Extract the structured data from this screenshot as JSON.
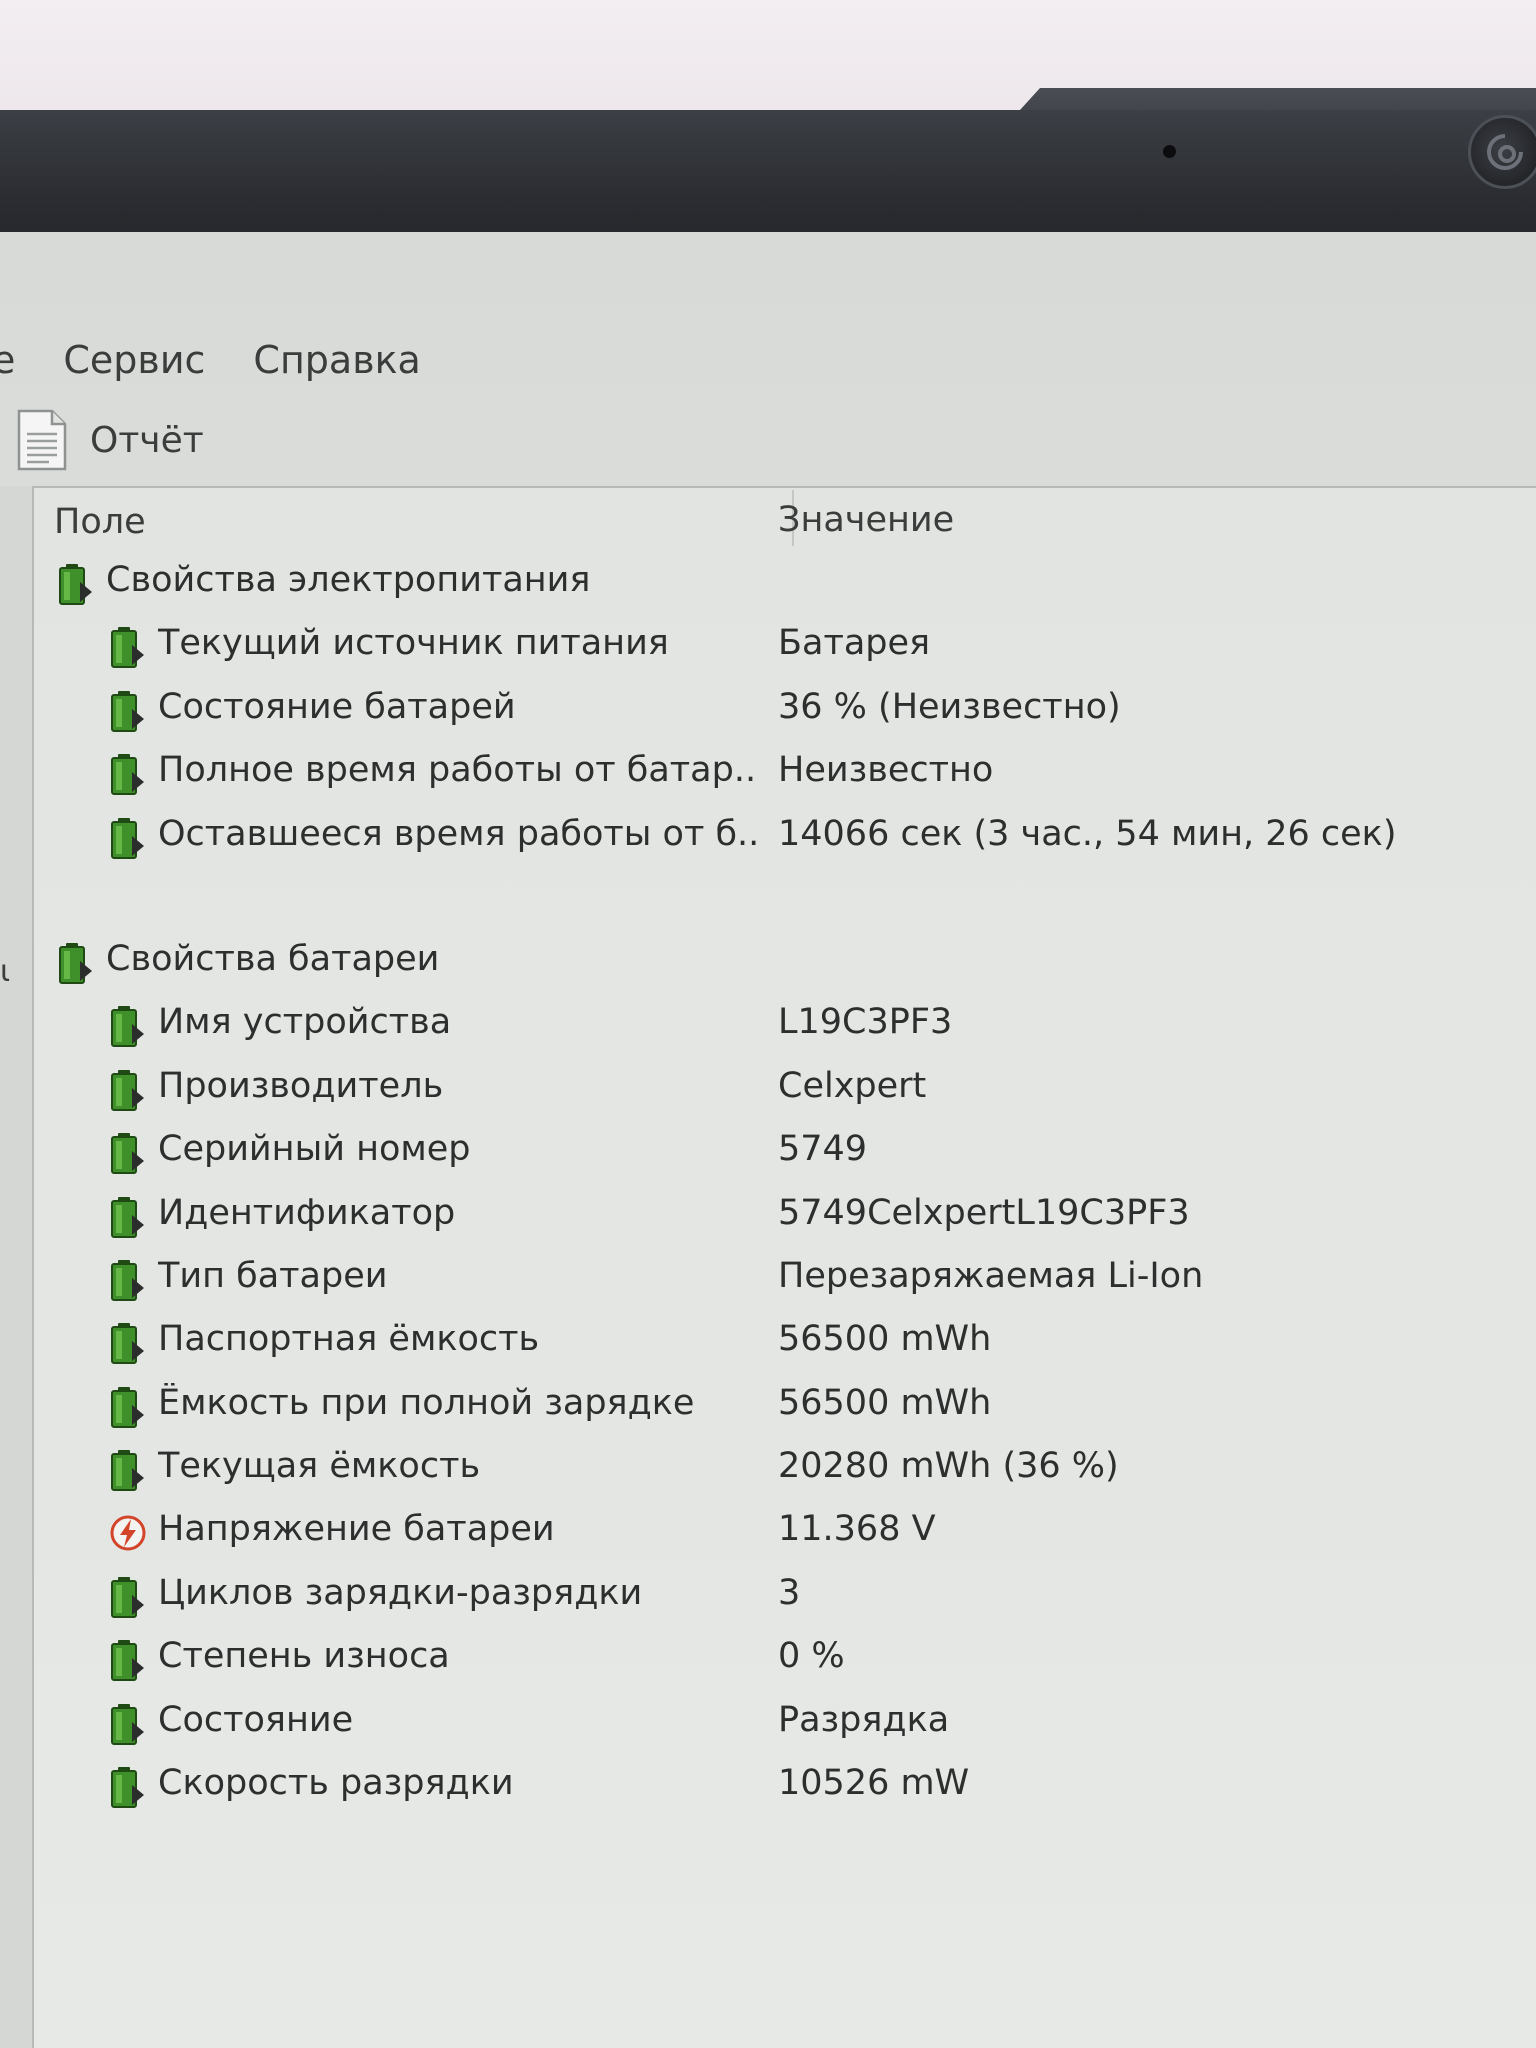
{
  "menu": {
    "items": [
      "е",
      "Сервис",
      "Справка"
    ]
  },
  "toolbar": {
    "report_label": "Отчёт"
  },
  "left_edge": {
    "glyph": "ι"
  },
  "table": {
    "columns": {
      "field": "Поле",
      "value": "Значение"
    },
    "rows": [
      {
        "kind": "group",
        "icon": "battery-icon",
        "label": "Свойства электропитания",
        "value": ""
      },
      {
        "kind": "item",
        "icon": "battery-icon",
        "label": "Текущий источник питания",
        "value": "Батарея"
      },
      {
        "kind": "item",
        "icon": "battery-icon",
        "label": "Состояние батарей",
        "value": "36 % (Неизвестно)"
      },
      {
        "kind": "item",
        "icon": "battery-icon",
        "label": "Полное время работы от батар...",
        "value": "Неизвестно"
      },
      {
        "kind": "item",
        "icon": "battery-icon",
        "label": "Оставшееся время работы от б...",
        "value": "14066 сек (3 час., 54 мин, 26 сек)"
      },
      {
        "kind": "gap"
      },
      {
        "kind": "group",
        "icon": "battery-icon",
        "label": "Свойства батареи",
        "value": ""
      },
      {
        "kind": "item",
        "icon": "battery-icon",
        "label": "Имя устройства",
        "value": "L19C3PF3"
      },
      {
        "kind": "item",
        "icon": "battery-icon",
        "label": "Производитель",
        "value": "Celxpert"
      },
      {
        "kind": "item",
        "icon": "battery-icon",
        "label": "Серийный номер",
        "value": "5749"
      },
      {
        "kind": "item",
        "icon": "battery-icon",
        "label": "Идентификатор",
        "value": "5749CelxpertL19C3PF3"
      },
      {
        "kind": "item",
        "icon": "battery-icon",
        "label": "Тип батареи",
        "value": "Перезаряжаемая Li-Ion"
      },
      {
        "kind": "item",
        "icon": "battery-icon",
        "label": "Паспортная ёмкость",
        "value": "56500 mWh"
      },
      {
        "kind": "item",
        "icon": "battery-icon",
        "label": "Ёмкость при полной зарядке",
        "value": "56500 mWh"
      },
      {
        "kind": "item",
        "icon": "battery-icon",
        "label": "Текущая ёмкость",
        "value": "20280 mWh  (36 %)"
      },
      {
        "kind": "item",
        "icon": "voltage-icon",
        "label": "Напряжение батареи",
        "value": "11.368 V"
      },
      {
        "kind": "item",
        "icon": "battery-icon",
        "label": "Циклов зарядки-разрядки",
        "value": "3"
      },
      {
        "kind": "item",
        "icon": "battery-icon",
        "label": "Степень износа",
        "value": "0 %"
      },
      {
        "kind": "item",
        "icon": "battery-icon",
        "label": "Состояние",
        "value": "Разрядка"
      },
      {
        "kind": "item",
        "icon": "battery-icon",
        "label": "Скорость разрядки",
        "value": "10526 mW"
      }
    ]
  },
  "colors": {
    "battery_green": "#3f8f2a",
    "battery_dark": "#1f4a14",
    "voltage_red": "#d2452b"
  }
}
